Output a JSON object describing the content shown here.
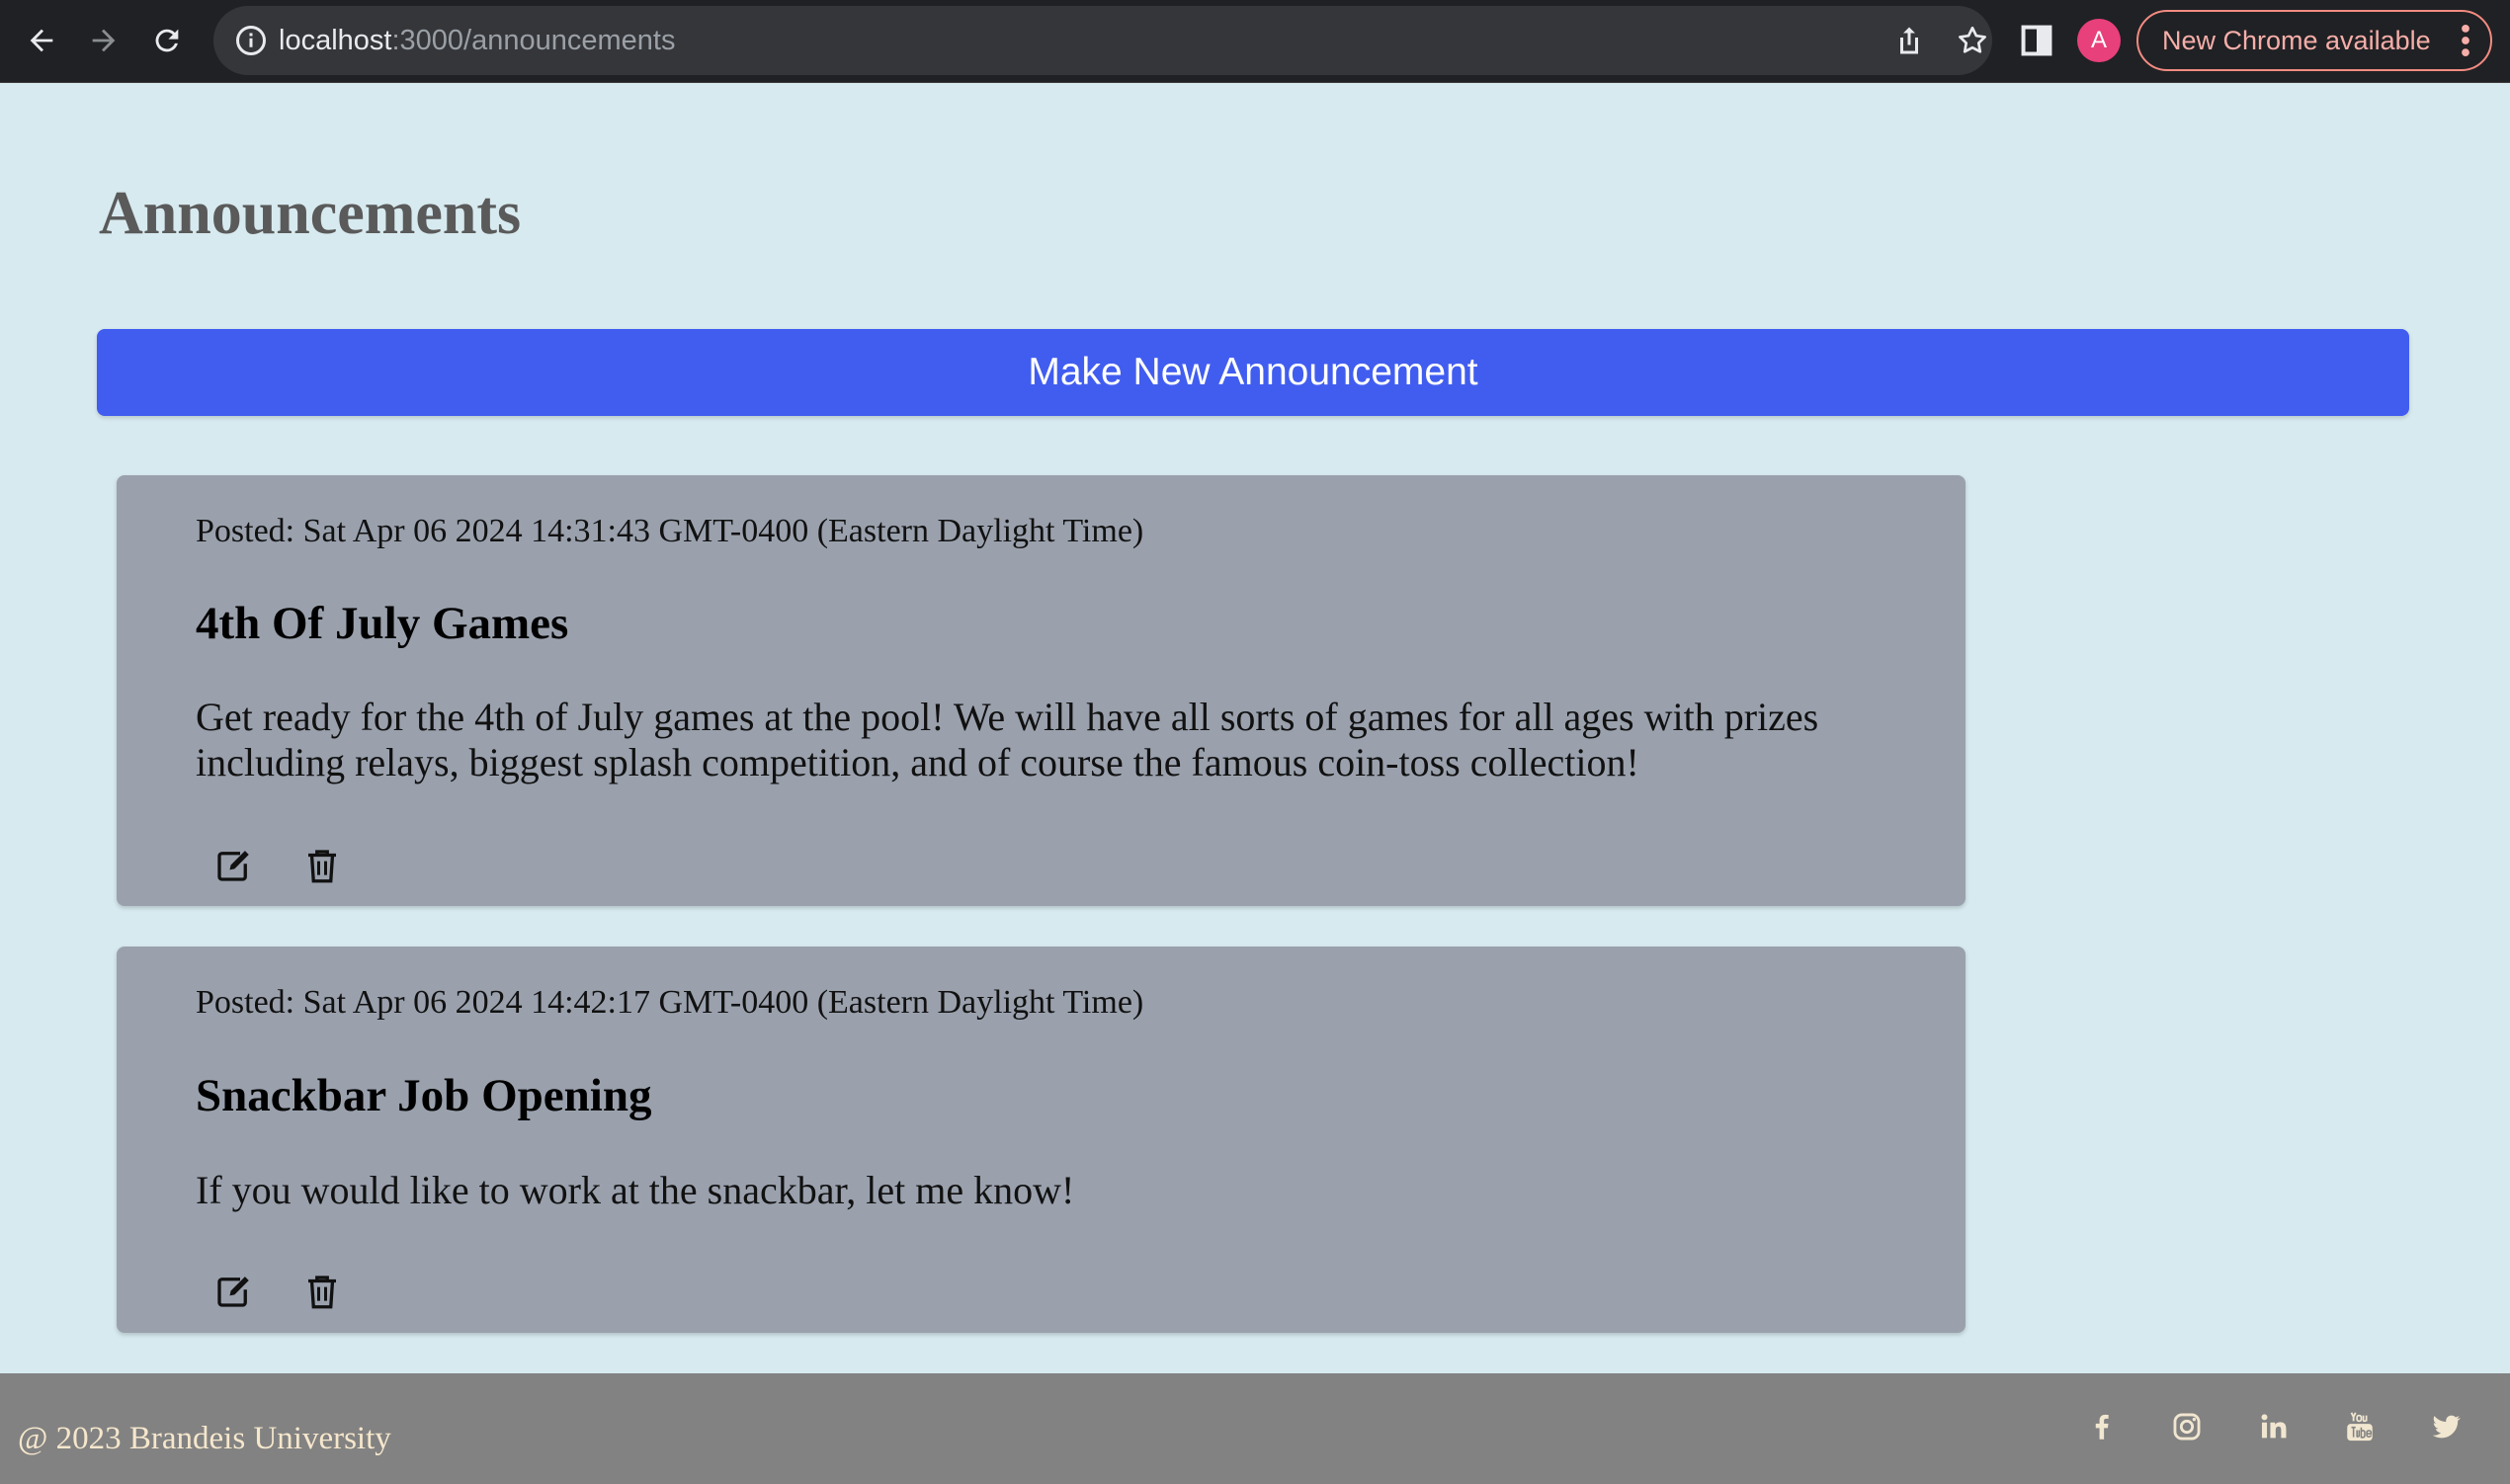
{
  "browser": {
    "url_host": "localhost",
    "url_path": ":3000/announcements",
    "avatar_letter": "A",
    "update_label": "New Chrome available"
  },
  "page": {
    "title": "Announcements",
    "new_button_label": "Make New Announcement"
  },
  "announcements": [
    {
      "posted": "Posted: Sat Apr 06 2024 14:31:43 GMT-0400 (Eastern Daylight Time)",
      "title": "4th Of July Games",
      "body": "Get ready for the 4th of July games at the pool! We will have all sorts of games for all ages with prizes including relays, biggest splash competition, and of course the famous coin-toss collection!"
    },
    {
      "posted": "Posted: Sat Apr 06 2024 14:42:17 GMT-0400 (Eastern Daylight Time)",
      "title": "Snackbar Job Opening",
      "body": "If you would like to work at the snackbar, let me know!"
    }
  ],
  "footer": {
    "copyright": "@ 2023 Brandeis University",
    "social_icons": [
      "facebook-icon",
      "instagram-icon",
      "linkedin-icon",
      "youtube-icon",
      "twitter-icon"
    ]
  },
  "colors": {
    "page_bg": "#d7eaef",
    "primary_button": "#415df0",
    "card_bg": "#9aa1ad",
    "footer_bg": "#828282",
    "footer_text": "#f6e7cc"
  }
}
